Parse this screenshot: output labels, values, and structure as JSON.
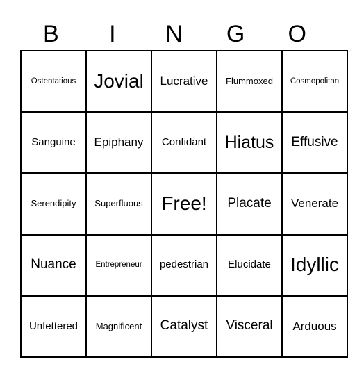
{
  "header": [
    "B",
    "I",
    "N",
    "G",
    "O"
  ],
  "board": [
    [
      "Ostentatious",
      "Jovial",
      "Lucrative",
      "Flummoxed",
      "Cosmopolitan"
    ],
    [
      "Sanguine",
      "Epiphany",
      "Confidant",
      "Hiatus",
      "Effusive"
    ],
    [
      "Serendipity",
      "Superfluous",
      "Free!",
      "Placate",
      "Venerate"
    ],
    [
      "Nuance",
      "Entrepreneur",
      "pedestrian",
      "Elucidate",
      "Idyllic"
    ],
    [
      "Unfettered",
      "Magnificent",
      "Catalyst",
      "Visceral",
      "Arduous"
    ]
  ]
}
